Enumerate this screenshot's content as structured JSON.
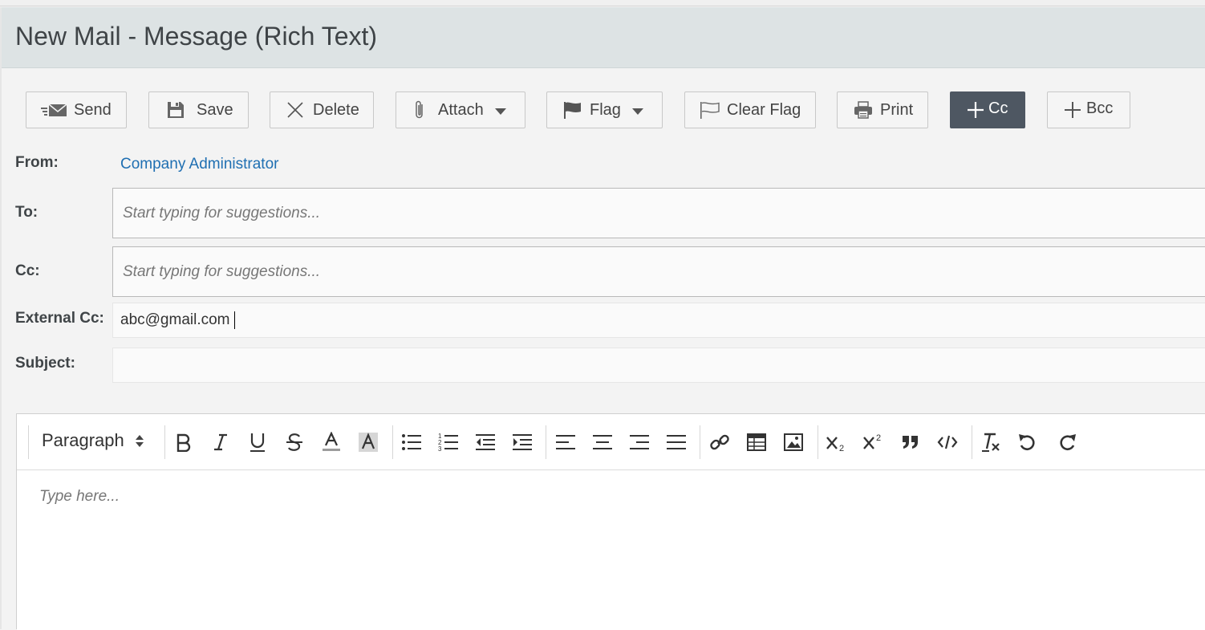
{
  "window": {
    "title": "New Mail - Message (Rich Text)"
  },
  "toolbar": {
    "send": "Send",
    "save": "Save",
    "delete": "Delete",
    "attach": "Attach",
    "flag": "Flag",
    "clear_flag": "Clear Flag",
    "print": "Print",
    "cc": "Cc",
    "bcc": "Bcc"
  },
  "form": {
    "from_label": "From:",
    "from_value": "Company Administrator",
    "to_label": "To:",
    "to_placeholder": "Start typing for suggestions...",
    "cc_label": "Cc:",
    "cc_placeholder": "Start typing for suggestions...",
    "external_cc_label": "External Cc:",
    "external_cc_value": "abc@gmail.com",
    "subject_label": "Subject:",
    "subject_value": ""
  },
  "editor": {
    "block_format": "Paragraph",
    "body_placeholder": "Type here...",
    "tools": [
      "bold-icon",
      "italic-icon",
      "underline-icon",
      "strikethrough-icon",
      "text-color-icon",
      "highlight-color-icon",
      "bullet-list-icon",
      "numbered-list-icon",
      "outdent-icon",
      "indent-icon",
      "align-left-icon",
      "align-center-icon",
      "align-right-icon",
      "justify-icon",
      "link-icon",
      "table-icon",
      "image-icon",
      "subscript-icon",
      "superscript-icon",
      "blockquote-icon",
      "code-icon",
      "clear-format-icon",
      "undo-icon",
      "redo-icon"
    ]
  },
  "colors": {
    "title_bar": "#dde3e4",
    "active_button": "#4e5762",
    "link": "#1f6fb2"
  }
}
